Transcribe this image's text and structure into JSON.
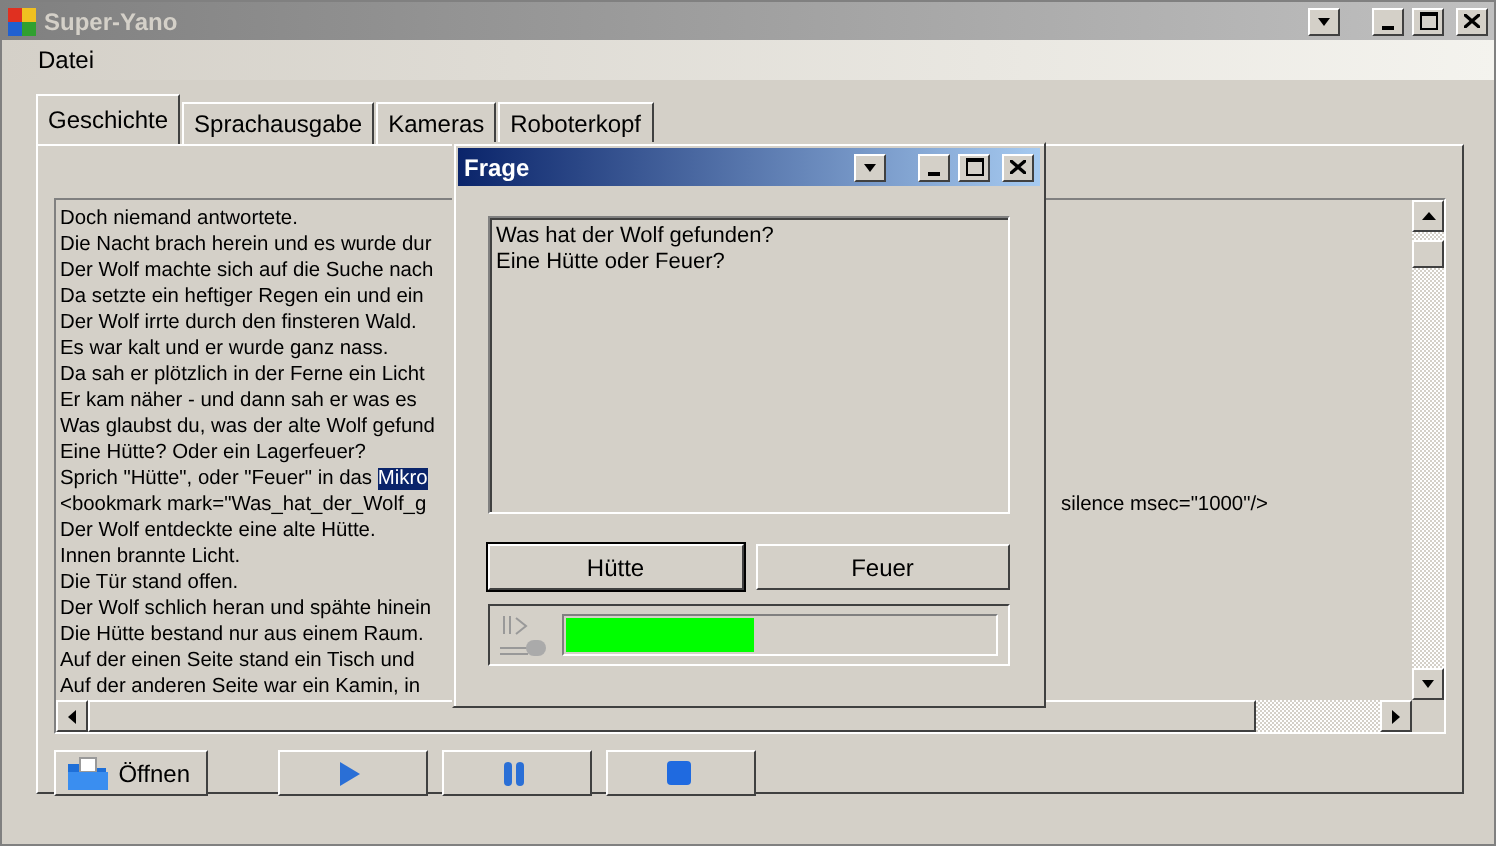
{
  "window": {
    "title": "Super-Yano"
  },
  "menu": [
    "Datei"
  ],
  "tabs": [
    {
      "label": "Geschichte",
      "selected": true
    },
    {
      "label": "Sprachausgabe",
      "selected": false
    },
    {
      "label": "Kameras",
      "selected": false
    },
    {
      "label": "Roboterkopf",
      "selected": false
    }
  ],
  "story": {
    "lines": [
      {
        "text": "Doch niemand antwortete."
      },
      {
        "text": "Die Nacht brach herein und es wurde dur"
      },
      {
        "text": "Der Wolf machte sich auf die Suche nach"
      },
      {
        "text": "Da setzte ein heftiger Regen ein und ein"
      },
      {
        "text": "Der Wolf irrte durch den finsteren Wald."
      },
      {
        "text": "Es war kalt und er wurde ganz nass."
      },
      {
        "text": "Da sah er plötzlich in der Ferne ein Licht"
      },
      {
        "text": "Er kam näher - und dann sah er was es"
      },
      {
        "text": "Was glaubst du, was der alte Wolf gefund"
      },
      {
        "text": "Eine Hütte? Oder ein Lagerfeuer?"
      },
      {
        "text": "Sprich \"Hütte\", oder \"Feuer\" in das ",
        "highlight": "Mikro"
      },
      {
        "text": "<bookmark mark=\"Was_hat_der_Wolf_g",
        "tail": "silence msec=\"1000\"/>"
      },
      {
        "text": "Der Wolf entdeckte eine alte Hütte."
      },
      {
        "text": "Innen brannte Licht."
      },
      {
        "text": "Die Tür stand offen."
      },
      {
        "text": "Der Wolf schlich heran und spähte hinein"
      },
      {
        "text": "Die Hütte bestand nur aus einem Raum."
      },
      {
        "text": "Auf der einen Seite stand ein Tisch und"
      },
      {
        "text": "Auf der anderen Seite war ein Kamin, in"
      }
    ]
  },
  "toolbar": [
    {
      "kind": "open",
      "label": "Öffnen"
    },
    {
      "kind": "play"
    },
    {
      "kind": "pause"
    },
    {
      "kind": "stop"
    }
  ],
  "dialog": {
    "title": "Frage",
    "question": [
      "Was hat der Wolf gefunden?",
      "Eine Hütte oder Feuer?"
    ],
    "answers": [
      {
        "label": "Hütte",
        "default": true
      },
      {
        "label": "Feuer",
        "default": false
      }
    ],
    "microphone": {
      "level": 0.44
    }
  }
}
